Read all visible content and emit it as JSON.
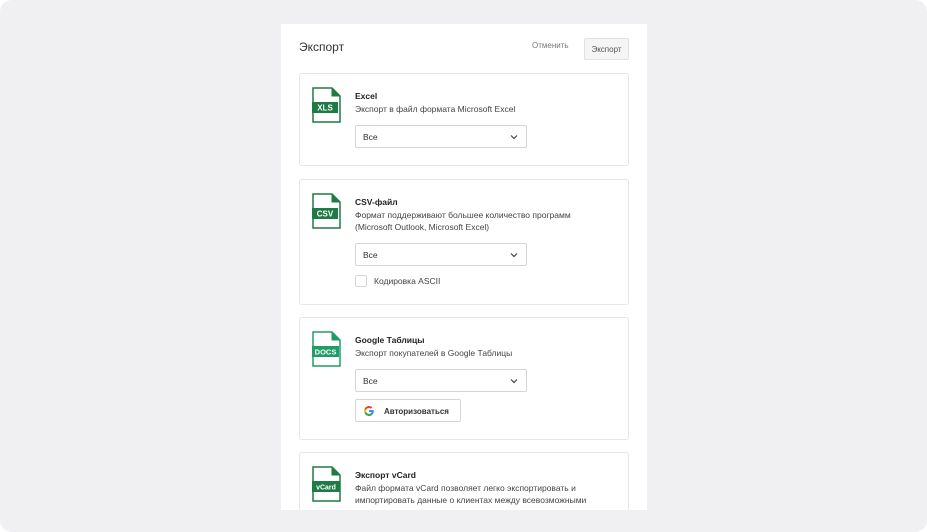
{
  "header": {
    "title": "Экспорт",
    "cancel_label": "Отменить",
    "export_label": "Экспорт"
  },
  "cards": {
    "excel": {
      "icon_label": "XLS",
      "icon": "xls-file-icon",
      "title": "Excel",
      "desc": "Экспорт в файл формата Microsoft Excel",
      "select_value": "Все"
    },
    "csv": {
      "icon_label": "CSV",
      "icon": "csv-file-icon",
      "title": "CSV-файл",
      "desc_line1": "Формат поддерживают большее количество программ",
      "desc_line2": "(Microsoft Outlook, Microsoft Excel)",
      "select_value": "Все",
      "checkbox_label": "Кодировка ASCII",
      "checkbox_checked": false
    },
    "google": {
      "icon_label": "DOCS",
      "icon": "docs-file-icon",
      "title": "Google Таблицы",
      "desc": "Экспорт покупателей в Google Таблицы",
      "select_value": "Все",
      "auth_label": "Авторизоваться",
      "auth_icon": "google-icon"
    },
    "vcard": {
      "icon_label": "vCard",
      "icon": "vcard-file-icon",
      "title": "Экспорт vCard",
      "desc_line1": "Файл формата vCard позволяет легко экспортировать и",
      "desc_line2": "импортировать данные о клиентах между всевозможными"
    }
  },
  "colors": {
    "file_icon_green": "#1e7b45",
    "background": "#f0f0f2"
  }
}
